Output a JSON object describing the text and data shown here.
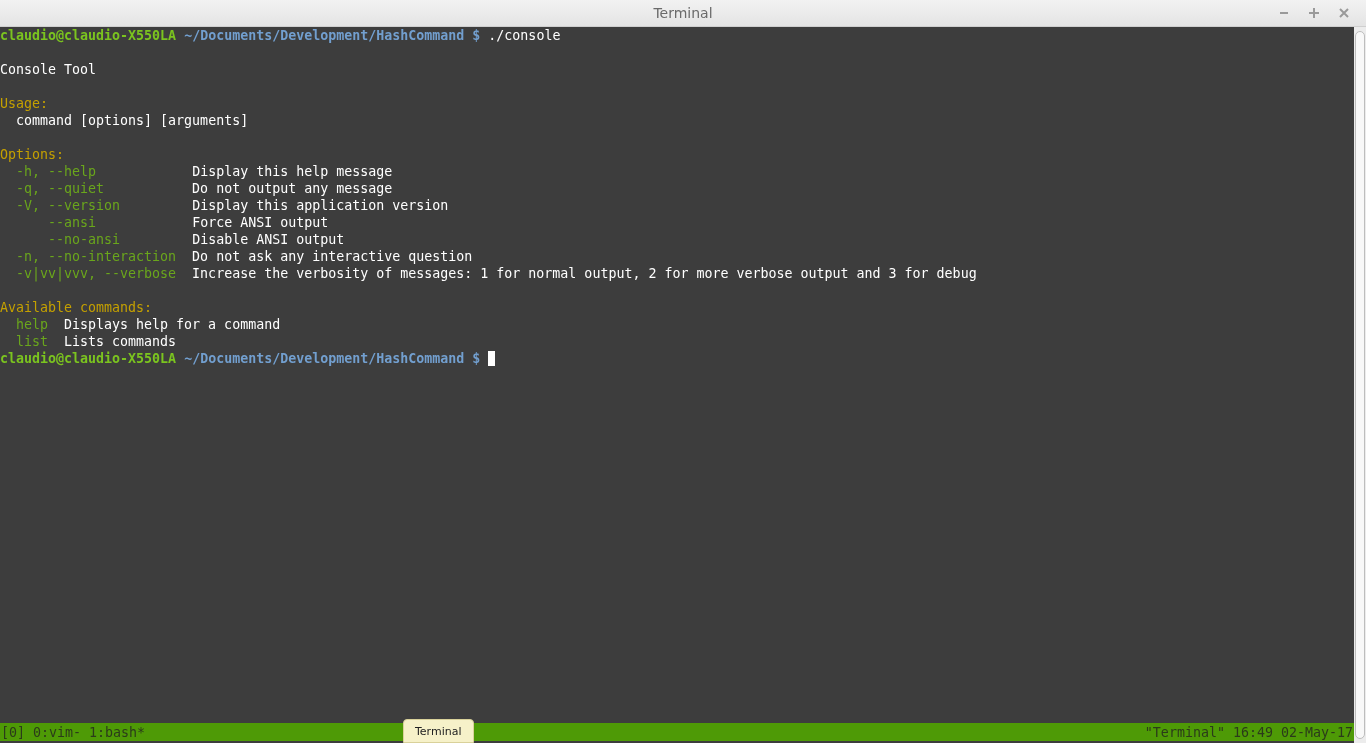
{
  "window": {
    "title": "Terminal",
    "controls": [
      {
        "kind": "minimize"
      },
      {
        "kind": "maximize"
      },
      {
        "kind": "close"
      }
    ]
  },
  "lines": [
    {
      "kind": "prompt",
      "user": "claudio@claudio-X550LA",
      "path": "~/Documents/Development/HashCommand",
      "symbol": "$",
      "command": "./console"
    },
    {
      "kind": "blank"
    },
    {
      "kind": "text",
      "text": "Console Tool"
    },
    {
      "kind": "blank"
    },
    {
      "kind": "heading",
      "text": "Usage:"
    },
    {
      "kind": "usage",
      "text": "command [options] [arguments]"
    },
    {
      "kind": "blank"
    },
    {
      "kind": "heading",
      "text": "Options:"
    },
    {
      "kind": "option",
      "flag": "-h, --help",
      "description": "Display this help message"
    },
    {
      "kind": "option",
      "flag": "-q, --quiet",
      "description": "Do not output any message"
    },
    {
      "kind": "option",
      "flag": "-V, --version",
      "description": "Display this application version"
    },
    {
      "kind": "long_option",
      "flag": "--ansi",
      "description": "Force ANSI output"
    },
    {
      "kind": "long_option",
      "flag": "--no-ansi",
      "description": "Disable ANSI output"
    },
    {
      "kind": "option",
      "flag": "-n, --no-interaction",
      "description": "Do not ask any interactive question"
    },
    {
      "kind": "option",
      "flag": "-v|vv|vvv, --verbose",
      "description": "Increase the verbosity of messages: 1 for normal output, 2 for more verbose output and 3 for debug"
    },
    {
      "kind": "blank"
    },
    {
      "kind": "heading",
      "text": "Available commands:"
    },
    {
      "kind": "command",
      "name": "help",
      "description": "Displays help for a command"
    },
    {
      "kind": "command",
      "name": "list",
      "description": "Lists commands"
    },
    {
      "kind": "prompt",
      "user": "claudio@claudio-X550LA",
      "path": "~/Documents/Development/HashCommand",
      "symbol": "$",
      "cursor": true
    }
  ],
  "status_bar": {
    "left": "[0] 0:vim- 1:bash*",
    "right": "\"Terminal\" 16:49 02-May-17"
  },
  "tooltip": {
    "text": "Terminal"
  }
}
